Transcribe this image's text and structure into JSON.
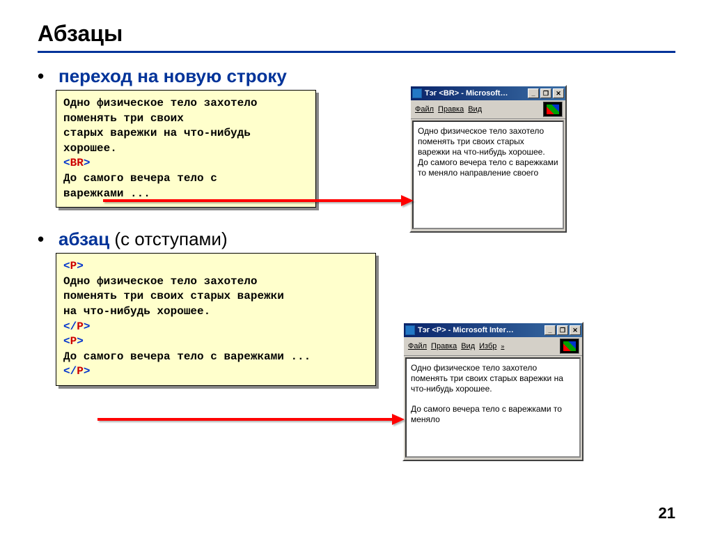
{
  "title": "Абзацы",
  "bullet1_hl": "переход на новую строку",
  "bullet2_hl": "абзац",
  "bullet2_plain": " (с отступами)",
  "code1": {
    "l1": "Одно физическое тело захотело",
    "l2": "поменять три своих",
    "l3": "старых варежки на что-нибудь",
    "l4": "хорошее.",
    "tag_open": "<",
    "tag_name": "BR",
    "tag_close": ">",
    "l5": "До самого вечера тело с",
    "l6": "варежками ..."
  },
  "code2": {
    "tag_open": "<",
    "tag_p": "P",
    "tag_close": ">",
    "tag_slash_open": "</",
    "l1": "Одно физическое тело захотело",
    "l2": "поменять три своих старых варежки",
    "l3": "на что-нибудь хорошее.",
    "l4": "До самого вечера тело с варежками ..."
  },
  "browser1": {
    "title": "Тэг <BR> - Microsoft…",
    "menu": {
      "file": "Файл",
      "edit": "Правка",
      "view": "Вид"
    },
    "text": "Одно физическое тело захотело поменять три своих старых варежки на что-нибудь хорошее.\nДо самого вечера тело с варежками то меняло направление своего"
  },
  "browser2": {
    "title": "Тэг <P> - Microsoft Inter…",
    "menu": {
      "file": "Файл",
      "edit": "Правка",
      "view": "Вид",
      "fav": "Избр",
      "chev": "»"
    },
    "p1": "Одно физическое тело захотело поменять три своих старых варежки на что-нибудь хорошее.",
    "p2": "До самого вечера тело с варежками то меняло"
  },
  "page": "21"
}
